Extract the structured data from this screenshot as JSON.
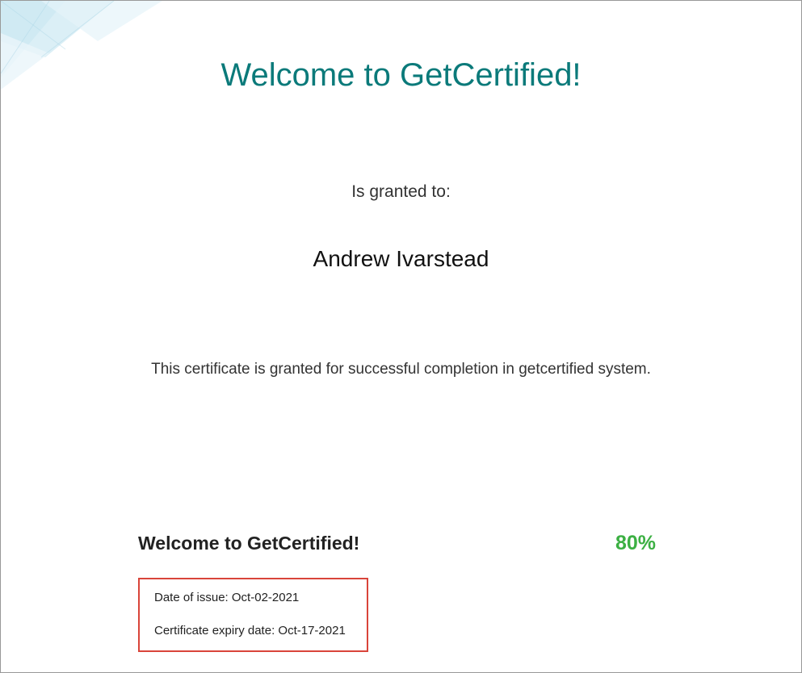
{
  "header": {
    "main_title": "Welcome to GetCertified!"
  },
  "body": {
    "granted_label": "Is granted to:",
    "recipient_name": "Andrew  Ivarstead",
    "description": "This certificate is granted for successful completion in getcertified system."
  },
  "footer": {
    "title": "Welcome to GetCertified!",
    "score": "80%",
    "issue_label": "Date of issue: ",
    "issue_date": "Oct-02-2021",
    "expiry_label": "Certificate expiry date: ",
    "expiry_date": "Oct-17-2021"
  }
}
